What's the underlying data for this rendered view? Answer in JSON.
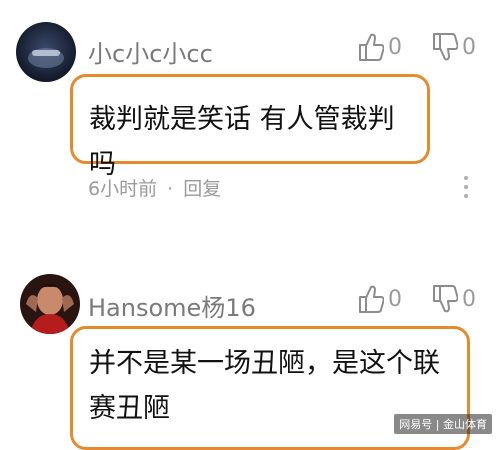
{
  "comments": [
    {
      "username": "小c小c小cc",
      "like_count": "0",
      "dislike_count": "0",
      "text": "裁判就是笑话 有人管裁判吗",
      "time": "6小时前",
      "separator": "·",
      "reply_label": "回复",
      "avatar_icon": "user-avatar-dark-icon"
    },
    {
      "username": "Hansome杨16",
      "like_count": "0",
      "dislike_count": "0",
      "text": "并不是某一场丑陋，是这个联赛丑陋",
      "avatar_icon": "user-avatar-photo-icon"
    }
  ],
  "watermark": "网易号 | 金山体育",
  "colors": {
    "highlight_border": "#e58b2e",
    "username": "#7a7a7a",
    "meta": "#9a9a9a"
  }
}
